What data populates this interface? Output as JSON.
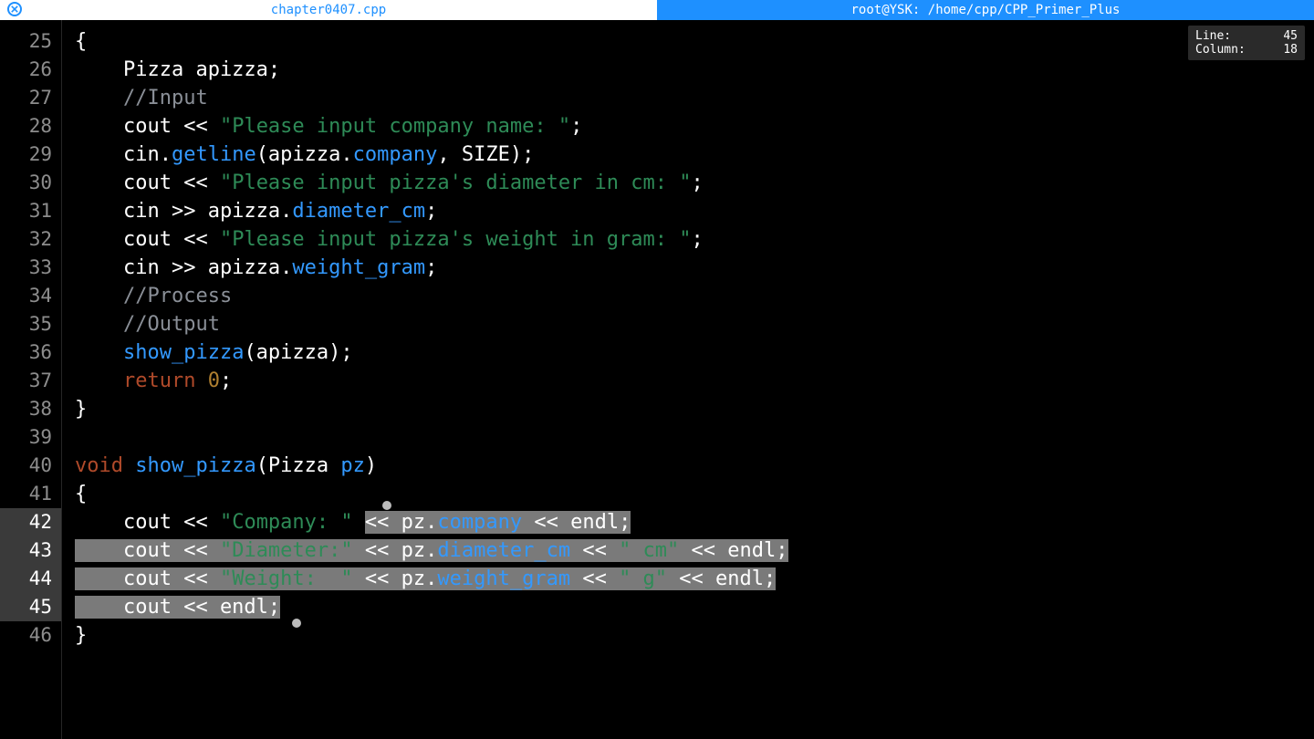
{
  "tabs": {
    "left": "chapter0407.cpp",
    "right": "root@YSK: /home/cpp/CPP_Primer_Plus"
  },
  "status": {
    "line_label": "Line:",
    "line_value": "45",
    "col_label": "Column:",
    "col_value": "18"
  },
  "gutter": {
    "l25": "25",
    "l26": "26",
    "l27": "27",
    "l28": "28",
    "l29": "29",
    "l30": "30",
    "l31": "31",
    "l32": "32",
    "l33": "33",
    "l34": "34",
    "l35": "35",
    "l36": "36",
    "l37": "37",
    "l38": "38",
    "l39": "39",
    "l40": "40",
    "l41": "41",
    "l42": "42",
    "l43": "43",
    "l44": "44",
    "l45": "45",
    "l46": "46"
  },
  "code": {
    "l25": {
      "a": "{"
    },
    "l26": {
      "a": "    Pizza apizza;"
    },
    "l27": {
      "a": "    ",
      "b": "//Input"
    },
    "l28": {
      "a": "    cout << ",
      "b": "\"Please input company name: \"",
      "c": ";"
    },
    "l29": {
      "a": "    cin.",
      "b": "getline",
      "c": "(apizza.",
      "d": "company",
      "e": ", SIZE);"
    },
    "l30": {
      "a": "    cout << ",
      "b": "\"Please input pizza's diameter in cm: \"",
      "c": ";"
    },
    "l31": {
      "a": "    cin >> apizza.",
      "b": "diameter_cm",
      "c": ";"
    },
    "l32": {
      "a": "    cout << ",
      "b": "\"Please input pizza's weight in gram: \"",
      "c": ";"
    },
    "l33": {
      "a": "    cin >> apizza.",
      "b": "weight_gram",
      "c": ";"
    },
    "l34": {
      "a": "    ",
      "b": "//Process"
    },
    "l35": {
      "a": "    ",
      "b": "//Output"
    },
    "l36": {
      "a": "    ",
      "b": "show_pizza",
      "c": "(apizza);"
    },
    "l37": {
      "a": "    ",
      "b": "return",
      "c": " ",
      "d": "0",
      "e": ";"
    },
    "l38": {
      "a": "}"
    },
    "l39": {
      "a": ""
    },
    "l40": {
      "a": "void",
      "b": " ",
      "c": "show_pizza",
      "d": "(Pizza ",
      "e": "pz",
      "f": ")"
    },
    "l41": {
      "a": "{"
    },
    "l42": {
      "a": "    cout << ",
      "b": "\"Company: \"",
      "c": " ",
      "d": "<< pz.",
      "e": "company",
      "f": " << endl;"
    },
    "l43": {
      "a": "    cout << ",
      "b": "\"Diameter:\"",
      "c": " << pz.",
      "d": "diameter_cm",
      "e": " << ",
      "f": "\" cm\"",
      "g": " << endl;"
    },
    "l44": {
      "a": "    cout << ",
      "b": "\"Weight:  \"",
      "c": " << pz.",
      "d": "weight_gram",
      "e": " << ",
      "f": "\" g\"",
      "g": " << endl;"
    },
    "l45": {
      "a": "    cout << endl;"
    },
    "l46": {
      "a": "}"
    }
  }
}
